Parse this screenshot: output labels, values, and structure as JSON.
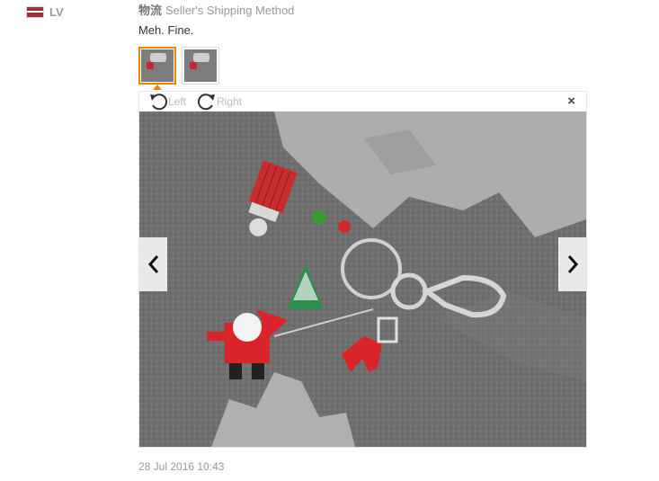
{
  "reviewer": {
    "country_code": "LV",
    "flag_icon": "latvia-flag-icon"
  },
  "review": {
    "shipping_prefix": "物流",
    "shipping_method": "Seller's Shipping Method",
    "comment": "Meh. Fine.",
    "date": "28 Jul 2016 10:43"
  },
  "viewer": {
    "rotate_left_label": "Left",
    "rotate_right_label": "Right",
    "close_glyph": "×",
    "prev_icon": "chevron-left-icon",
    "next_icon": "chevron-right-icon"
  },
  "colors": {
    "accent": "#f08300",
    "muted": "#999999"
  }
}
